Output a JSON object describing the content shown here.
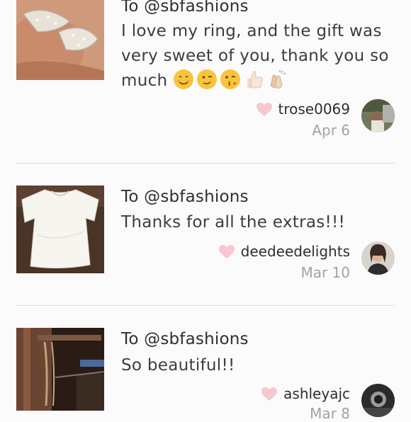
{
  "reviews": [
    {
      "to": "To @sbfashions",
      "message": "I love my ring, and the gift was very sweet of you, thank you so much",
      "emojis": [
        "smiling-face-icon",
        "winking-face-icon",
        "face-blowing-kiss-icon",
        "thumbs-up-icon",
        "clapping-hands-icon"
      ],
      "username": "trose0069",
      "date": "Apr 6",
      "thumbnail": "ring-photo"
    },
    {
      "to": "To @sbfashions",
      "message": "Thanks for all the extras!!!",
      "username": "deedeedelights",
      "date": "Mar 10",
      "thumbnail": "white-tshirt-photo"
    },
    {
      "to": "To @sbfashions",
      "message": "So beautiful!!",
      "username": "ashleyajc",
      "date": "Mar 8",
      "thumbnail": "necklaces-photo"
    }
  ],
  "colors": {
    "heart": "#f7c6cf",
    "divider": "#dedede",
    "date": "#a3a3a3"
  }
}
